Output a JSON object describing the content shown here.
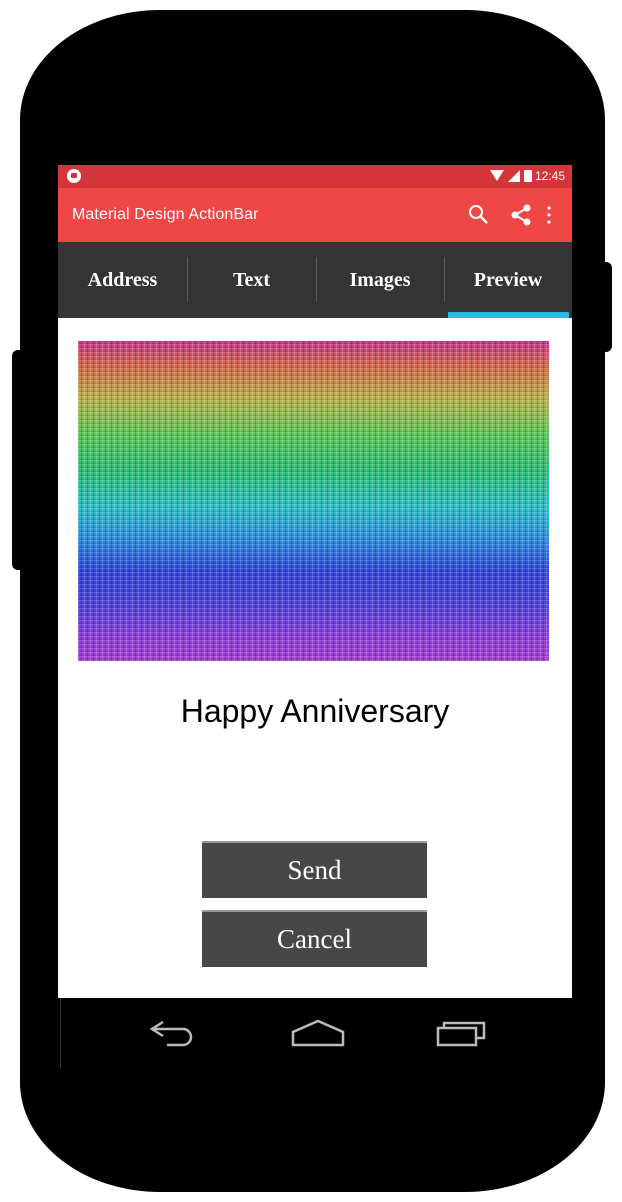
{
  "status_bar": {
    "time": "12:45",
    "icons": [
      "notification-icon",
      "wifi-icon",
      "signal-icon",
      "battery-icon"
    ]
  },
  "action_bar": {
    "title": "Material Design ActionBar",
    "actions": [
      "search-icon",
      "share-icon",
      "overflow-menu-icon"
    ],
    "color": "#ef4646"
  },
  "tabs": [
    {
      "label": "Address",
      "active": false
    },
    {
      "label": "Text",
      "active": false
    },
    {
      "label": "Images",
      "active": false
    },
    {
      "label": "Preview",
      "active": true
    }
  ],
  "tab_indicator_color": "#33b5e5",
  "preview": {
    "image": "rainbow-noise-image",
    "caption": "Happy Anniversary"
  },
  "buttons": {
    "send": "Send",
    "cancel": "Cancel"
  },
  "nav_bar": [
    "back-icon",
    "home-icon",
    "recents-icon"
  ]
}
